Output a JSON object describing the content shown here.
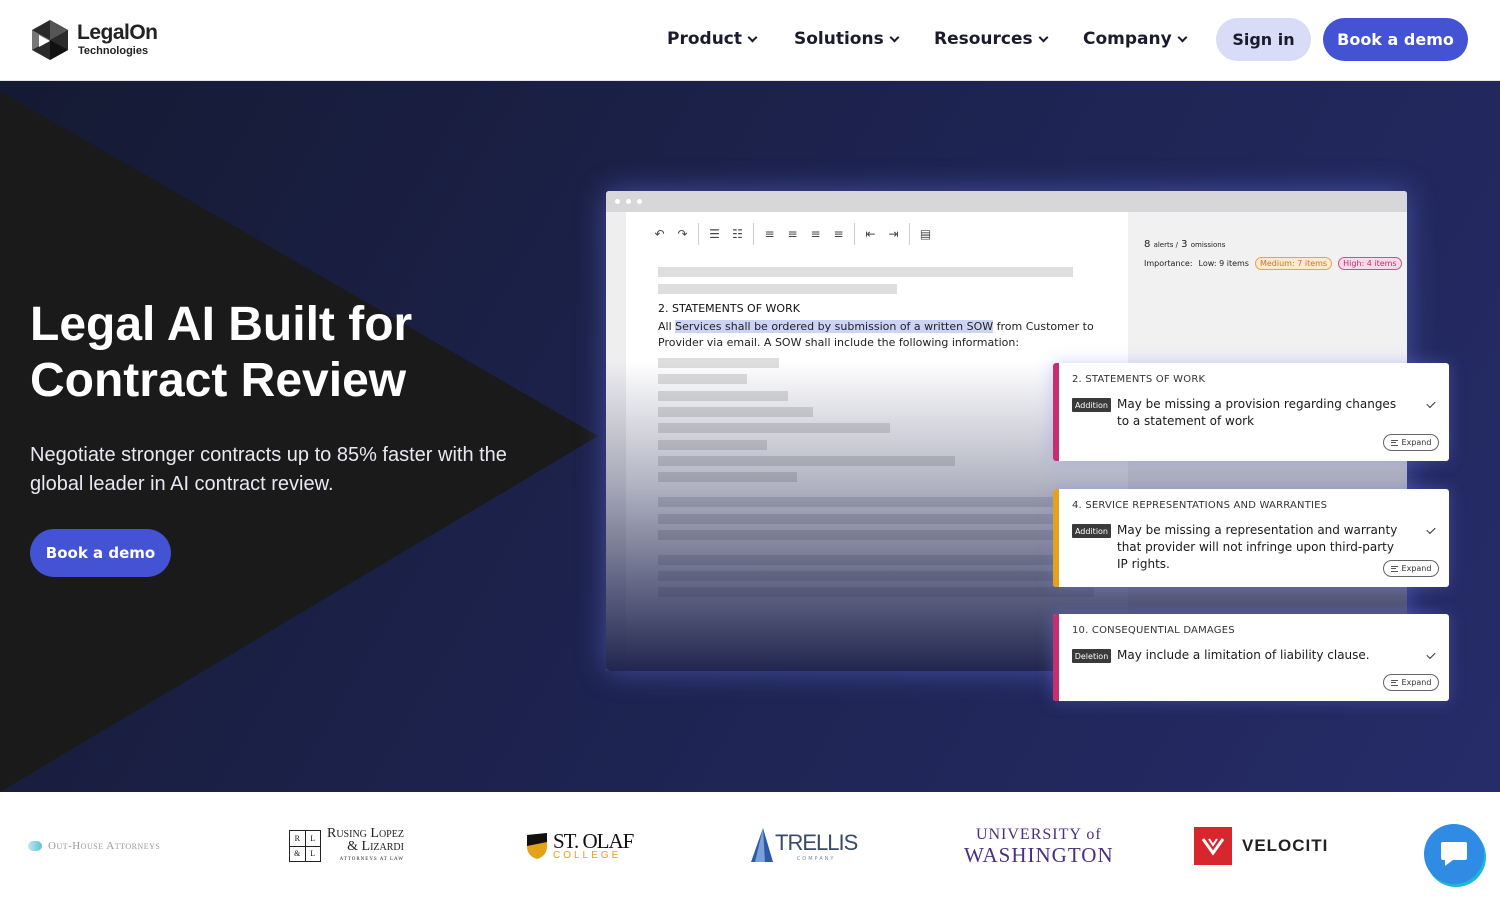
{
  "brand": {
    "name": "LegalOn",
    "sub": "Technologies"
  },
  "nav": {
    "items": [
      {
        "label": "Product"
      },
      {
        "label": "Solutions"
      },
      {
        "label": "Resources"
      },
      {
        "label": "Company"
      }
    ],
    "signin_label": "Sign in",
    "demo_label": "Book a demo"
  },
  "hero": {
    "title": "Legal AI Built for Contract Review",
    "subtitle": "Negotiate stronger contracts up to 85% faster with the global leader in AI contract review.",
    "cta_label": "Book a demo"
  },
  "app": {
    "doc_heading": "2. STATEMENTS OF WORK",
    "doc_text_pre": "All ",
    "doc_text_highlight": "Services shall be ordered by submission of a written SOW",
    "doc_text_post": " from Customer to Provider via email. A SOW shall include the following information:",
    "alerts_count": "8",
    "alerts_label": "alerts /",
    "omissions_count": "3",
    "omissions_label": "omissions",
    "importance_label": "Importance:",
    "low_label": "Low: 9 items",
    "medium_label": "Medium: 7 items",
    "high_label": "High: 4 items"
  },
  "cards": [
    {
      "title": "2. STATEMENTS OF WORK",
      "tag": "Addition",
      "message": "May be missing a provision regarding changes to a statement of work",
      "expand_label": "Expand",
      "accent": "#c2306f"
    },
    {
      "title": "4. SERVICE REPRESENTATIONS AND WARRANTIES",
      "tag": "Addition",
      "message": "May be missing a representation and warranty that provider will not infringe upon third-party IP rights.",
      "expand_label": "Expand",
      "accent": "#e3a21a"
    },
    {
      "title": "10. CONSEQUENTIAL DAMAGES",
      "tag": "Deletion",
      "message": "May include a limitation of liability clause.",
      "expand_label": "Expand",
      "accent": "#c2306f"
    }
  ],
  "logos": {
    "outhouse": "Out-House Attorneys",
    "rusing_box": [
      "R",
      "L",
      "&",
      "L"
    ],
    "rusing_1": "Rusing Lopez",
    "rusing_2": "& Lizardi",
    "rusing_3": "ATTORNEYS AT LAW",
    "stolaf_1": "ST. OLAF",
    "stolaf_2": "COLLEGE",
    "trellis_1": "TRELLIS",
    "trellis_2": "COMPANY",
    "uw_1": "UNIVERSITY of",
    "uw_2": "WASHINGTON",
    "velociti": "VELOCITI"
  },
  "colors": {
    "accent": "#4452d4",
    "signin_bg": "#d9dcf6",
    "hero_bg": "#1e2452"
  }
}
